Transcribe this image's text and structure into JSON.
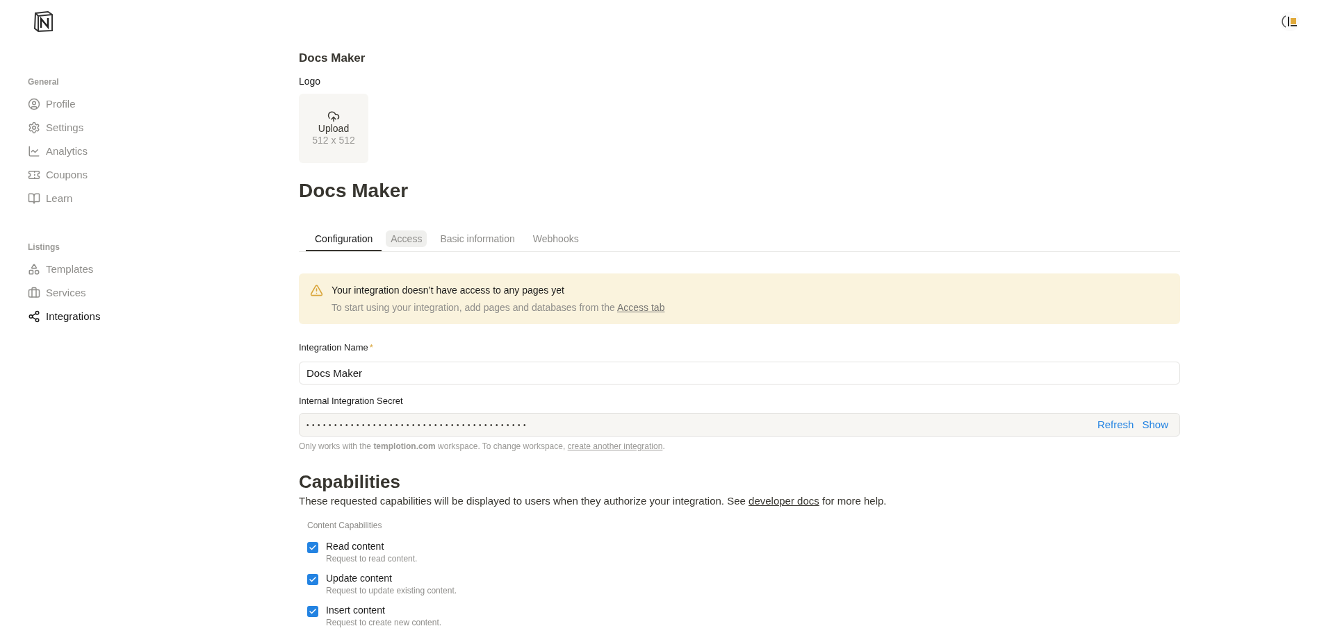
{
  "sidebar": {
    "sections": [
      {
        "title": "General",
        "items": [
          {
            "label": "Profile",
            "selected": false
          },
          {
            "label": "Settings",
            "selected": false
          },
          {
            "label": "Analytics",
            "selected": false
          },
          {
            "label": "Coupons",
            "selected": false
          },
          {
            "label": "Learn",
            "selected": false
          }
        ]
      },
      {
        "title": "Listings",
        "items": [
          {
            "label": "Templates",
            "selected": false
          },
          {
            "label": "Services",
            "selected": false
          },
          {
            "label": "Integrations",
            "selected": true
          }
        ]
      }
    ]
  },
  "header": {
    "title": "Docs Maker",
    "logo_label": "Logo",
    "upload": {
      "label": "Upload",
      "size": "512 x 512"
    }
  },
  "page_title": "Docs Maker",
  "tabs": [
    {
      "label": "Configuration",
      "selected": true,
      "hovered": false
    },
    {
      "label": "Access",
      "selected": false,
      "hovered": true
    },
    {
      "label": "Basic information",
      "selected": false,
      "hovered": false
    },
    {
      "label": "Webhooks",
      "selected": false,
      "hovered": false
    }
  ],
  "alert": {
    "title": "Your integration doesn’t have access to any pages yet",
    "text": "To start using your integration, add pages and databases from the",
    "link": "Access tab"
  },
  "name_field": {
    "label": "Integration Name",
    "required_mark": "*",
    "value": "Docs Maker"
  },
  "secret_field": {
    "label": "Internal Integration Secret",
    "value": "••••••••••••••••••••••••••••••••••••••••",
    "buttons": [
      "Refresh",
      "Show"
    ]
  },
  "secret_help": {
    "text": "Only works with the **templotion.com** workspace. To change workspace,",
    "link": "create another integration",
    "end": "."
  },
  "capabilities": {
    "title": "Capabilities",
    "description": "These requested capabilities will be displayed to users when they authorize your integration. See",
    "link": "developer docs",
    "description_end": "for more help.",
    "group_label": "Content Capabilities",
    "items": [
      {
        "label": "Read content",
        "hint": "Request to read content.",
        "checked": true
      },
      {
        "label": "Update content",
        "hint": "Request to update existing content.",
        "checked": true
      },
      {
        "label": "Insert content",
        "hint": "Request to create new content.",
        "checked": true
      }
    ]
  }
}
